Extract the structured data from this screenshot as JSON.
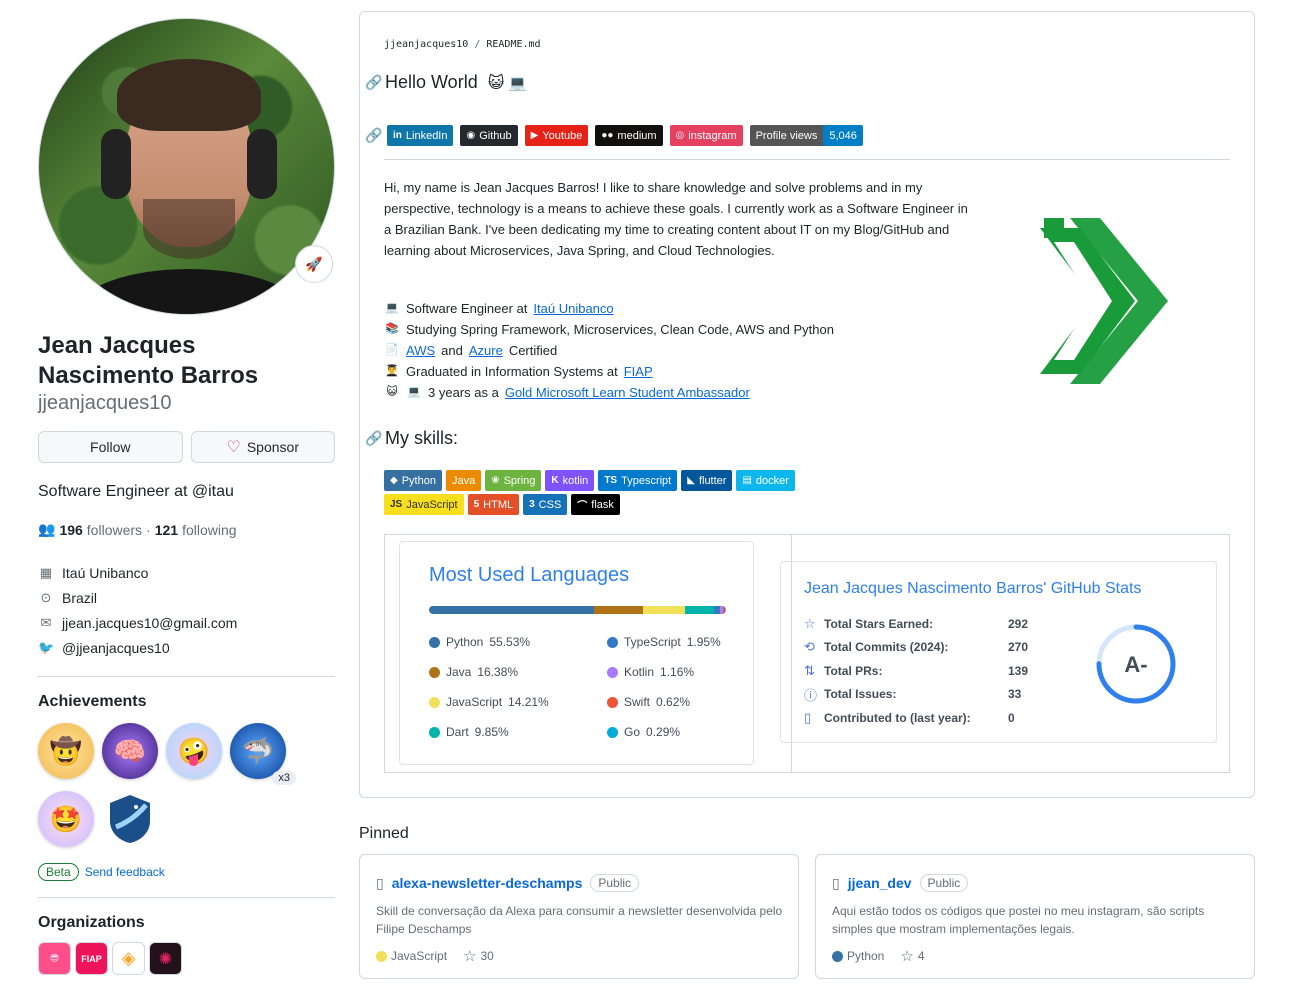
{
  "profile": {
    "name": "Jean Jacques Nascimento Barros",
    "username": "jjeanjacques10",
    "follow_label": "Follow",
    "sponsor_label": "Sponsor",
    "bio": "Software Engineer at @itau",
    "followers": "196",
    "followers_label": "followers",
    "following": "121",
    "following_label": "following",
    "company": "Itaú Unibanco",
    "location": "Brazil",
    "email": "jjean.jacques10@gmail.com",
    "twitter": "@jjeanjacques10",
    "achievements_title": "Achievements",
    "achievement_multiplier": "x3",
    "beta_label": "Beta",
    "feedback_label": "Send feedback",
    "organizations_title": "Organizations",
    "org_fiap": "FIAP"
  },
  "readme": {
    "owner": "jjeanjacques10",
    "file": "README.md",
    "heading": "Hello World",
    "social": [
      {
        "label": "LinkedIn",
        "glyph": "in",
        "color": "#0e76a8"
      },
      {
        "label": "Github",
        "glyph": "◉",
        "color": "#24292e"
      },
      {
        "label": "Youtube",
        "glyph": "▶",
        "color": "#e62117"
      },
      {
        "label": "medium",
        "glyph": "●●",
        "color": "#12100e"
      },
      {
        "label": "instagram",
        "glyph": "◎",
        "color": "#e4405f"
      }
    ],
    "views_label": "Profile views",
    "views_value": "5,046",
    "intro": "Hi, my name is Jean Jacques Barros! I like to share knowledge and solve problems and in my perspective, technology is a means to achieve these goals. I currently work as a Software Engineer in a Brazilian Bank. I've been dedicating my time to creating content about IT on my Blog/GitHub and learning about Microservices, Java Spring, and Cloud Technologies.",
    "facts": {
      "f1_text": "Software Engineer at",
      "f1_link": "Itaú Unibanco",
      "f2_text": "Studying Spring Framework, Microservices, Clean Code, AWS and Python",
      "f3_link1": "AWS",
      "f3_and": "and",
      "f3_link2": "Azure",
      "f3_text": "Certified",
      "f4_text": "Graduated in Information Systems at",
      "f4_link": "FIAP",
      "f5_text": "3 years as a",
      "f5_link": "Gold Microsoft Learn Student Ambassador"
    },
    "skills_heading": "My skills:",
    "skills": [
      {
        "label": "Python",
        "glyph": "◆",
        "color": "#3670a0",
        "text": "#ffffff"
      },
      {
        "label": "Java",
        "glyph": "",
        "color": "#ed8b00",
        "text": "#ffffff"
      },
      {
        "label": "Spring",
        "glyph": "❀",
        "color": "#6db33f",
        "text": "#ffffff"
      },
      {
        "label": "kotlin",
        "glyph": "K",
        "color": "#7f52ff",
        "text": "#ffffff"
      },
      {
        "label": "Typescript",
        "glyph": "TS",
        "color": "#007acc",
        "text": "#ffffff"
      },
      {
        "label": "flutter",
        "glyph": "◣",
        "color": "#02569b",
        "text": "#ffffff"
      },
      {
        "label": "docker",
        "glyph": "▤",
        "color": "#0db7ed",
        "text": "#ffffff"
      },
      {
        "label": "JavaScript",
        "glyph": "JS",
        "color": "#f7df1e",
        "text": "#323330"
      },
      {
        "label": "HTML",
        "glyph": "5",
        "color": "#e34f26",
        "text": "#ffffff"
      },
      {
        "label": "CSS",
        "glyph": "3",
        "color": "#1572b6",
        "text": "#ffffff"
      },
      {
        "label": "flask",
        "glyph": "⌒",
        "color": "#000000",
        "text": "#ffffff"
      }
    ]
  },
  "top_langs": {
    "title": "Most Used Languages",
    "items": [
      {
        "name": "Python",
        "percent": "55.53%",
        "value": 55.53,
        "color": "#3572a5"
      },
      {
        "name": "TypeScript",
        "percent": "1.95%",
        "value": 1.95,
        "color": "#3178c6"
      },
      {
        "name": "Java",
        "percent": "16.38%",
        "value": 16.38,
        "color": "#b07219"
      },
      {
        "name": "Kotlin",
        "percent": "1.16%",
        "value": 1.16,
        "color": "#a97bff"
      },
      {
        "name": "JavaScript",
        "percent": "14.21%",
        "value": 14.21,
        "color": "#f1e05a"
      },
      {
        "name": "Swift",
        "percent": "0.62%",
        "value": 0.62,
        "color": "#f05138"
      },
      {
        "name": "Dart",
        "percent": "9.85%",
        "value": 9.85,
        "color": "#00b4ab"
      },
      {
        "name": "Go",
        "percent": "0.29%",
        "value": 0.29,
        "color": "#00add8"
      }
    ]
  },
  "github_stats": {
    "title": "Jean Jacques Nascimento Barros' GitHub Stats",
    "rows": [
      {
        "label": "Total Stars Earned:",
        "value": "292",
        "icon": "star-icon",
        "glyph": "☆"
      },
      {
        "label": "Total Commits (2024):",
        "value": "270",
        "icon": "history-icon",
        "glyph": "⟲"
      },
      {
        "label": "Total PRs:",
        "value": "139",
        "icon": "pull-request-icon",
        "glyph": "⇅"
      },
      {
        "label": "Total Issues:",
        "value": "33",
        "icon": "issue-icon",
        "glyph": "ⓘ"
      },
      {
        "label": "Contributed to (last year):",
        "value": "0",
        "icon": "repo-icon",
        "glyph": "▯"
      }
    ],
    "grade": "A-",
    "grade_progress": 0.75,
    "accent": "#2f80ed"
  },
  "pinned": {
    "title": "Pinned",
    "repos": [
      {
        "name": "alexa-newsletter-deschamps",
        "visibility": "Public",
        "description": "Skill de conversação da Alexa para consumir a newsletter desenvolvida pelo Filipe Deschamps",
        "language": "JavaScript",
        "lang_color": "#f1e05a",
        "stars": "30"
      },
      {
        "name": "jjean_dev",
        "visibility": "Public",
        "description": "Aqui estão todos os códigos que postei no meu instagram, são scripts simples que mostram implementações legais.",
        "language": "Python",
        "lang_color": "#3572a5",
        "stars": "4"
      }
    ]
  }
}
